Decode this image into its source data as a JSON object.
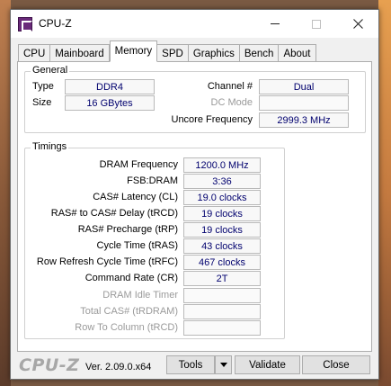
{
  "window": {
    "title": "CPU-Z"
  },
  "tabs": [
    "CPU",
    "Mainboard",
    "Memory",
    "SPD",
    "Graphics",
    "Bench",
    "About"
  ],
  "general": {
    "label": "General",
    "type_label": "Type",
    "type_value": "DDR4",
    "size_label": "Size",
    "size_value": "16 GBytes",
    "channel_label": "Channel #",
    "channel_value": "Dual",
    "dcmode_label": "DC Mode",
    "dcmode_value": "",
    "uncore_label": "Uncore Frequency",
    "uncore_value": "2999.3 MHz"
  },
  "timings": {
    "label": "Timings",
    "rows": [
      {
        "label": "DRAM Frequency",
        "value": "1200.0 MHz"
      },
      {
        "label": "FSB:DRAM",
        "value": "3:36"
      },
      {
        "label": "CAS# Latency (CL)",
        "value": "19.0 clocks"
      },
      {
        "label": "RAS# to CAS# Delay (tRCD)",
        "value": "19 clocks"
      },
      {
        "label": "RAS# Precharge (tRP)",
        "value": "19 clocks"
      },
      {
        "label": "Cycle Time (tRAS)",
        "value": "43 clocks"
      },
      {
        "label": "Row Refresh Cycle Time (tRFC)",
        "value": "467 clocks"
      },
      {
        "label": "Command Rate (CR)",
        "value": "2T"
      },
      {
        "label": "DRAM Idle Timer",
        "value": ""
      },
      {
        "label": "Total CAS# (tRDRAM)",
        "value": ""
      },
      {
        "label": "Row To Column (tRCD)",
        "value": ""
      }
    ]
  },
  "footer": {
    "logo": "CPU-Z",
    "version": "Ver. 2.09.0.x64",
    "tools_label": "Tools",
    "validate_label": "Validate",
    "close_label": "Close"
  },
  "icons": {
    "close": "close-icon",
    "minimize": "minimize-icon",
    "maximize": "maximize-icon",
    "dropdown": "caret-down-icon"
  }
}
